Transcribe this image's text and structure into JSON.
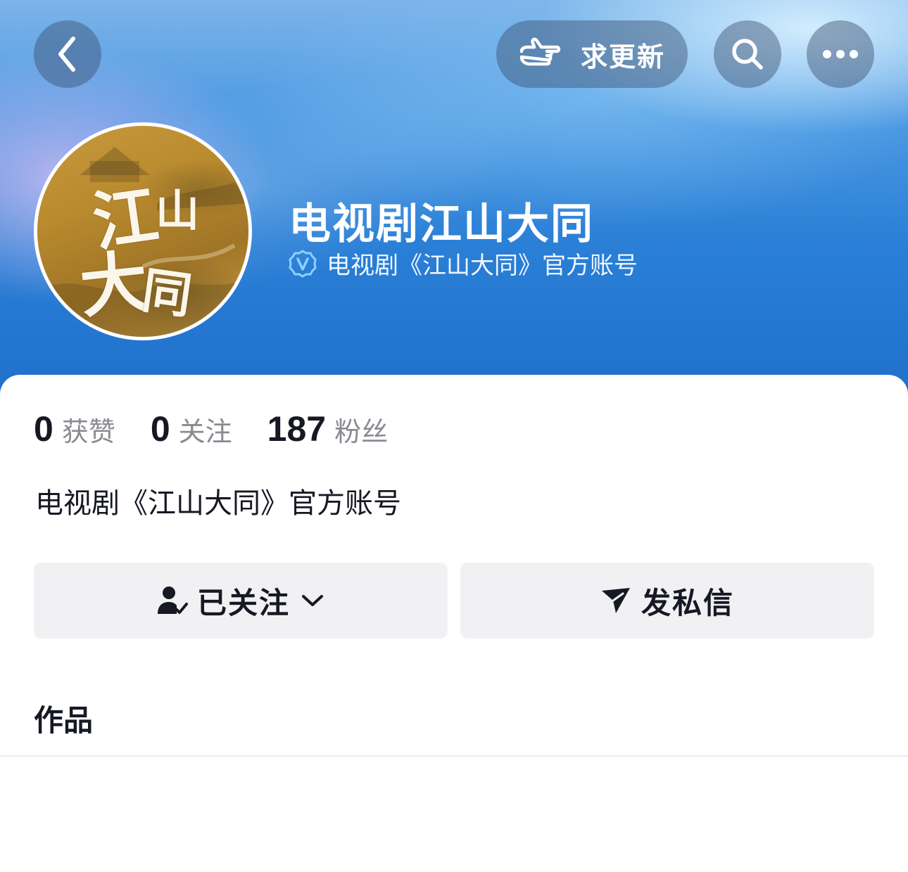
{
  "header": {
    "request_update_label": "求更新",
    "profile_name": "电视剧江山大同",
    "verified_text": "电视剧《江山大同》官方账号",
    "avatar_glyphs": [
      "江",
      "山",
      "大",
      "同"
    ]
  },
  "stats": [
    {
      "value": "0",
      "label": "获赞"
    },
    {
      "value": "0",
      "label": "关注"
    },
    {
      "value": "187",
      "label": "粉丝"
    }
  ],
  "bio": "电视剧《江山大同》官方账号",
  "actions": {
    "followed_label": "已关注",
    "message_label": "发私信"
  },
  "tabs": {
    "works_label": "作品"
  },
  "colors": {
    "header_blue": "#2a7fd6",
    "text_primary": "#161823",
    "text_secondary": "#8a8b91",
    "button_bg": "#f1f1f4"
  }
}
